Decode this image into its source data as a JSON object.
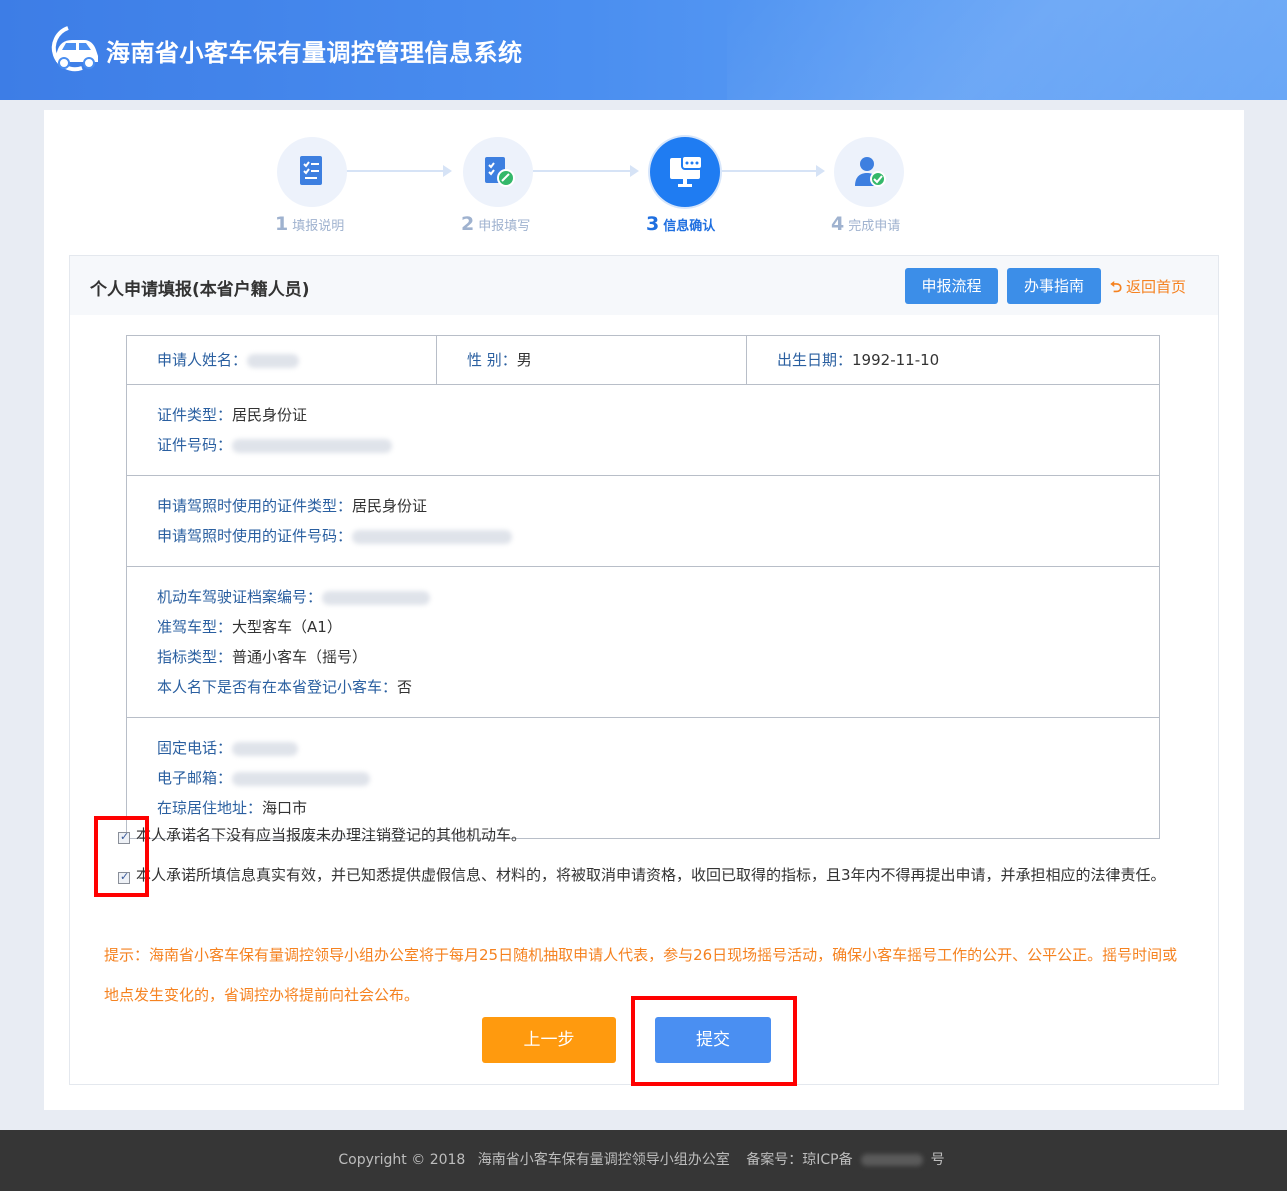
{
  "header": {
    "title": "海南省小客车保有量调控管理信息系统"
  },
  "steps": [
    {
      "num": "1",
      "label": "填报说明",
      "icon": "checklist-icon",
      "active": false
    },
    {
      "num": "2",
      "label": "申报填写",
      "icon": "edit-checklist-icon",
      "active": false
    },
    {
      "num": "3",
      "label": "信息确认",
      "icon": "monitor-chat-icon",
      "active": true
    },
    {
      "num": "4",
      "label": "完成申请",
      "icon": "user-check-icon",
      "active": false
    }
  ],
  "panel": {
    "title": "个人申请填报(本省户籍人员)",
    "btn_process": "申报流程",
    "btn_guide": "办事指南",
    "back_home": "返回首页"
  },
  "info": {
    "name_label": "申请人姓名：",
    "gender_label": "性 别：",
    "gender_value": "男",
    "birth_label": "出生日期：",
    "birth_value": "1992-11-10",
    "id_type_label": "证件类型：",
    "id_type_value": "居民身份证",
    "id_no_label": "证件号码：",
    "lic_id_type_label": "申请驾照时使用的证件类型：",
    "lic_id_type_value": "居民身份证",
    "lic_id_no_label": "申请驾照时使用的证件号码：",
    "file_no_label": "机动车驾驶证档案编号：",
    "vehicle_class_label": "准驾车型：",
    "vehicle_class_value": "大型客车（A1）",
    "quota_type_label": "指标类型：",
    "quota_type_value": "普通小客车（摇号）",
    "has_car_label": "本人名下是否有在本省登记小客车：",
    "has_car_value": "否",
    "phone_label": "固定电话：",
    "email_label": "电子邮箱：",
    "address_label": "在琼居住地址：",
    "address_value": "海口市"
  },
  "agreements": {
    "a1": "本人承诺名下没有应当报废未办理注销登记的其他机动车。",
    "a2": "本人承诺所填信息真实有效，并已知悉提供虚假信息、材料的，将被取消申请资格，收回已取得的指标，且3年内不得再提出申请，并承担相应的法律责任。"
  },
  "tip": "提示：海南省小客车保有量调控领导小组办公室将于每月25日随机抽取申请人代表，参与26日现场摇号活动，确保小客车摇号工作的公开、公平公正。摇号时间或地点发生变化的，省调控办将提前向社会公布。",
  "buttons": {
    "prev": "上一步",
    "submit": "提交"
  },
  "footer": {
    "copyright": "Copyright © 2018",
    "org": "海南省小客车保有量调控领导小组办公室",
    "icp_prefix": "备案号：琼ICP备",
    "icp_suffix": "号"
  },
  "colors": {
    "header": "#4a8ef0",
    "accent_orange": "#f58220",
    "primary": "#3c8ee8",
    "highlight_red": "#ff0000"
  }
}
